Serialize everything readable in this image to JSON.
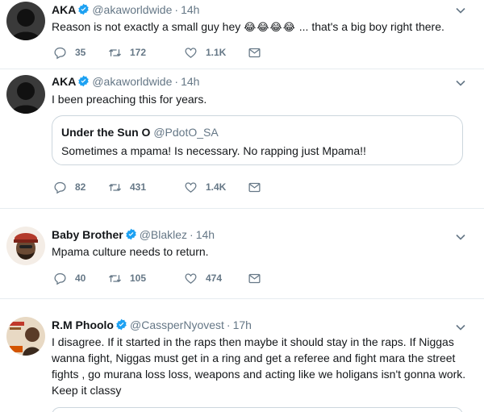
{
  "tweets": [
    {
      "name": "AKA",
      "handle": "@akaworldwide",
      "time": "14h",
      "text": "Reason is not exactly a small guy hey",
      "emoji": "😂😂😂😂",
      "text_after": "... that's a big boy right there.",
      "replies": "35",
      "retweets": "172",
      "likes": "1.1K",
      "avatar_icon": "default-silhouette"
    },
    {
      "name": "AKA",
      "handle": "@akaworldwide",
      "time": "14h",
      "text": "I been preaching this for years.",
      "quote": {
        "name": "Under the Sun O",
        "handle": "@PdotO_SA",
        "text": "Sometimes a mpama! Is necessary.  No rapping just Mpama!!"
      },
      "replies": "82",
      "retweets": "431",
      "likes": "1.4K",
      "avatar_icon": "default-silhouette"
    },
    {
      "name": "Baby Brother",
      "handle": "@Blaklez",
      "time": "14h",
      "text": "Mpama  culture needs to return.",
      "replies": "40",
      "retweets": "105",
      "likes": "474",
      "avatar_icon": "bearded-man-avatar"
    },
    {
      "name": "R.M Phoolo",
      "handle": "@CassperNyovest",
      "time": "17h",
      "text_lines": [
        "I disagree. If it started in the raps then maybe it should stay in the raps. If Niggas",
        "wanna fight, Niggas must get in a ring and get a referee and fight mara the street",
        "fights , go murana loss loss, weapons and acting like we holigans isn't gonna work.",
        "Keep it classy"
      ],
      "avatar_icon": "poster-avatar"
    }
  ],
  "colors": {
    "verified": "#1da1f2",
    "muted": "#657786",
    "text": "#14171a",
    "border": "#e6ecf0"
  }
}
